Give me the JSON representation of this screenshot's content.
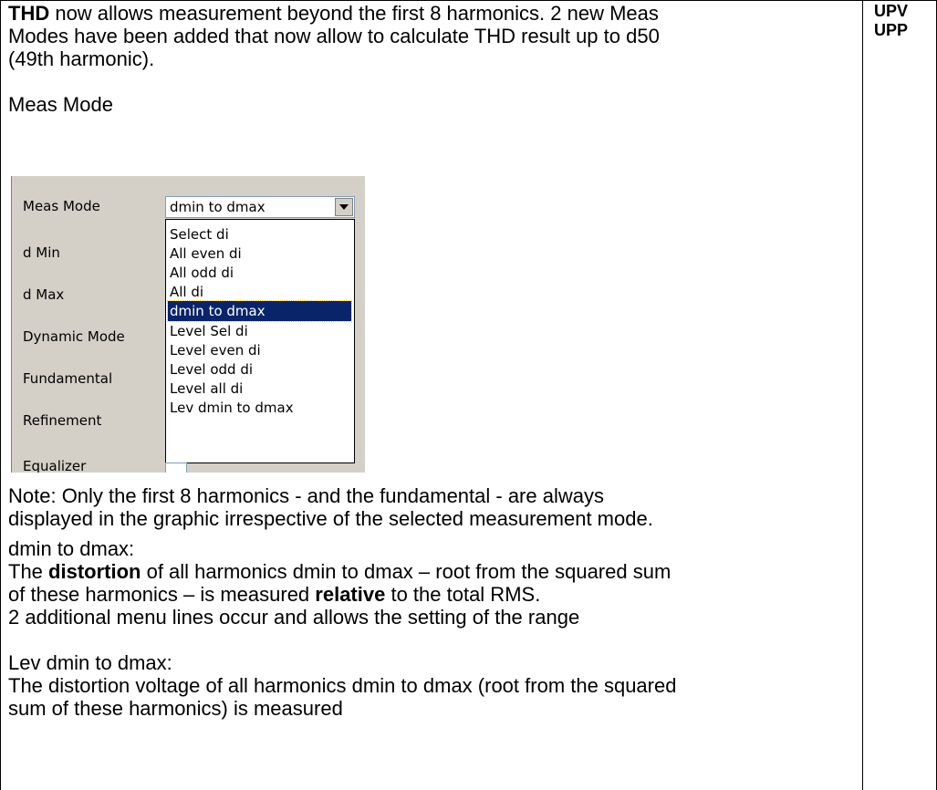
{
  "intro": {
    "bold": "THD",
    "rest_line1": " now allows measurement beyond the first 8 harmonics. 2 new Meas",
    "line2": "Modes have been added that now allow to calculate THD result up to d50",
    "line3": "(49th harmonic)."
  },
  "side_labels": [
    "UPV",
    "UPP"
  ],
  "meas_mode_heading": "Meas Mode",
  "dialog": {
    "labels": [
      "Meas Mode",
      "d Min",
      "d Max",
      "Dynamic Mode",
      "Fundamental",
      "Refinement",
      "Equalizer"
    ],
    "selected_value": "dmin to dmax",
    "dropdown_icon": "chevron-down-icon",
    "options": [
      "Select di",
      "All even di",
      "All odd di",
      "All di",
      "dmin to dmax",
      "Level Sel di",
      "Level even di",
      "Level odd di",
      "Level all di",
      "Lev dmin to dmax"
    ],
    "selected_index": 4
  },
  "note": {
    "line1": "Note: Only the first 8 harmonics - and the fundamental - are always",
    "line2": "displayed in the graphic irrespective of the selected measurement mode."
  },
  "dmin_section": {
    "title": "dmin to dmax:",
    "l1_a": "The ",
    "l1_b": "distortion",
    "l1_c": " of all harmonics dmin to dmax – root from the squared sum",
    "l2_a": "of these harmonics – is measured ",
    "l2_b": "relative",
    "l2_c": " to the total RMS.",
    "l3": "2 additional menu lines occur and allows the setting of the range"
  },
  "lev_section": {
    "title": "Lev dmin to dmax:",
    "l1": "The distortion voltage of all harmonics dmin to dmax (root from the squared",
    "l2": "sum of these harmonics) is measured"
  }
}
